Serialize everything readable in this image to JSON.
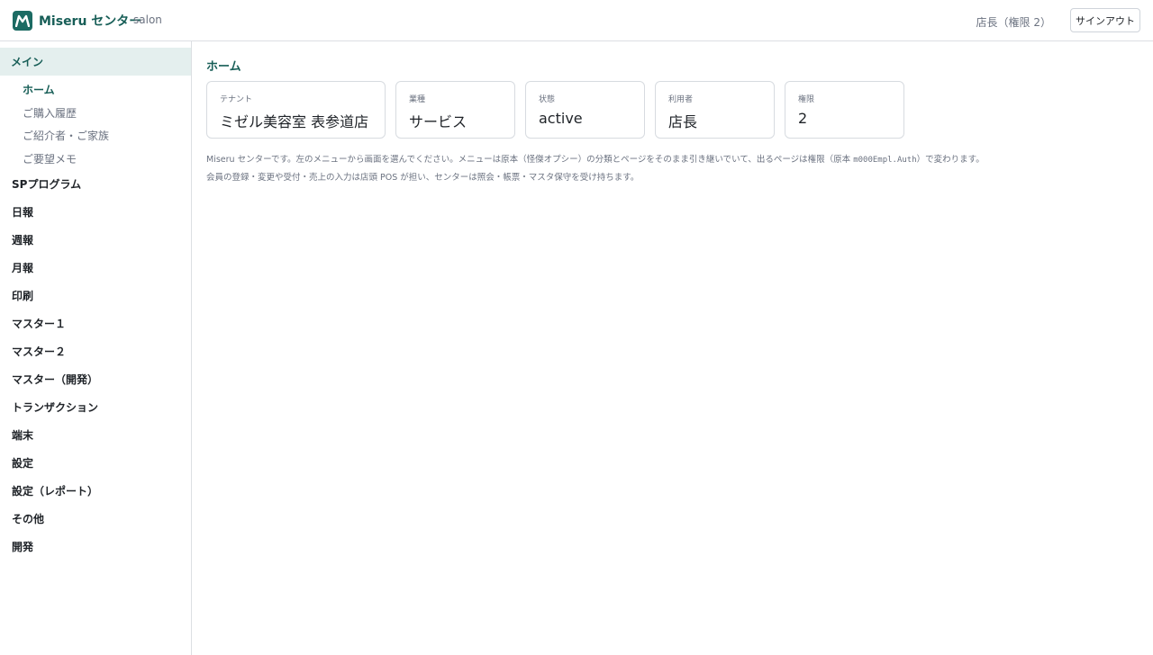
{
  "header": {
    "brand": "Miseru センター",
    "tenant_code": "salon",
    "user_role": "店長（権限 2）",
    "signout_label": "サインアウト",
    "logo_icon": "miseru-m-logo-icon"
  },
  "sidebar": {
    "active_group": "メイン",
    "sub_items": [
      "ホーム",
      "ご購入履歴",
      "ご紹介者・ご家族",
      "ご要望メモ"
    ],
    "groups": [
      "SPプログラム",
      "日報",
      "週報",
      "月報",
      "印刷",
      "マスター１",
      "マスター２",
      "マスター（開発）",
      "トランザクション",
      "端末",
      "設定",
      "設定（レポート）",
      "その他",
      "開発"
    ]
  },
  "main": {
    "title": "ホーム",
    "cards": [
      {
        "label": "テナント",
        "value": "ミゼル美容室 表参道店"
      },
      {
        "label": "業種",
        "value": "サービス"
      },
      {
        "label": "状態",
        "value": "active"
      },
      {
        "label": "利用者",
        "value": "店長"
      },
      {
        "label": "権限",
        "value": "2"
      }
    ],
    "desc_line1_a": "Miseru センターです。左のメニューから画面を選んでください。メニューは原本（怪傑オプシー）の分類とページをそのまま引き継いでいて、出るページは権限（原本 ",
    "desc_line1_code": "m000Empl.Auth",
    "desc_line1_b": "）で変わります。",
    "desc_line2": "会員の登録・変更や受付・売上の入力は店頭 POS が担い、センターは照会・帳票・マスタ保守を受け持ちます。"
  },
  "colors": {
    "accent": "#175e57",
    "active_bg": "#e4efee",
    "border": "#dcdfe3"
  }
}
